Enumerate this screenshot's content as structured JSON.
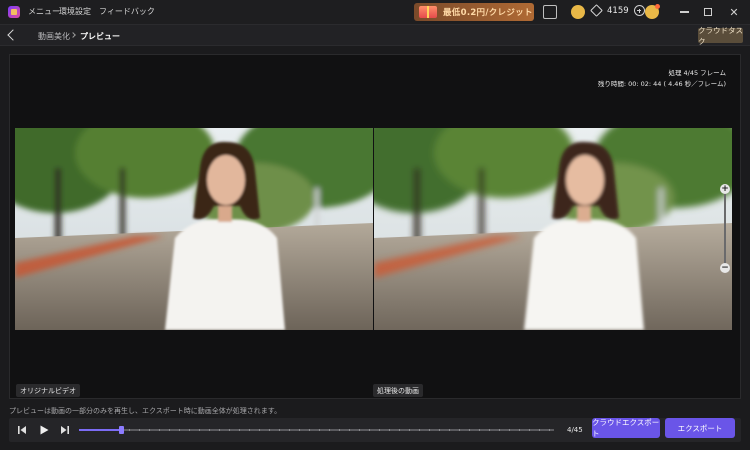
{
  "titlebar": {
    "menu": [
      "メニュー",
      "環境設定",
      "フィードバック"
    ],
    "promo_text": "最低0.2円/クレジット",
    "credits": "4159"
  },
  "breadcrumb": {
    "items": [
      "動画美化",
      "プレビュー"
    ],
    "cloud_task_label": "クラウドタスク"
  },
  "preview": {
    "processing_status": "処理 4/45 フレーム",
    "remaining_time": "残り時間: 00: 02: 44 ( 4.46 秒／フレーム)",
    "left_label": "オリジナルビデオ",
    "right_label": "処理後の動画"
  },
  "footer": {
    "info_text": "プレビューは動画の一部分のみを再生し、エクスポート時に動画全体が処理されます。",
    "frame_counter": "4/45",
    "progress_fraction": 0.0889,
    "cloud_export_label": "クラウドエクスポート",
    "export_label": "エクスポート"
  },
  "icons": {
    "app": "app-logo-icon",
    "promo": "gift-icon",
    "window_mode": "window-mode-icon",
    "coin": "coin-icon",
    "gem": "gem-icon",
    "add_credits": "plus-circle-icon",
    "avatar": "user-avatar-icon",
    "minimize": "minimize-icon",
    "maximize": "maximize-icon",
    "close": "close-icon",
    "back": "chevron-left-icon",
    "separator": "chevron-right-icon",
    "step_back": "step-back-icon",
    "play": "play-icon",
    "step_forward": "step-forward-icon",
    "zoom_in": "zoom-in-icon",
    "zoom_out": "zoom-out-icon"
  },
  "colors": {
    "accent": "#6a55e8",
    "background": "#1b1b1d",
    "promo": "#b06a34"
  }
}
